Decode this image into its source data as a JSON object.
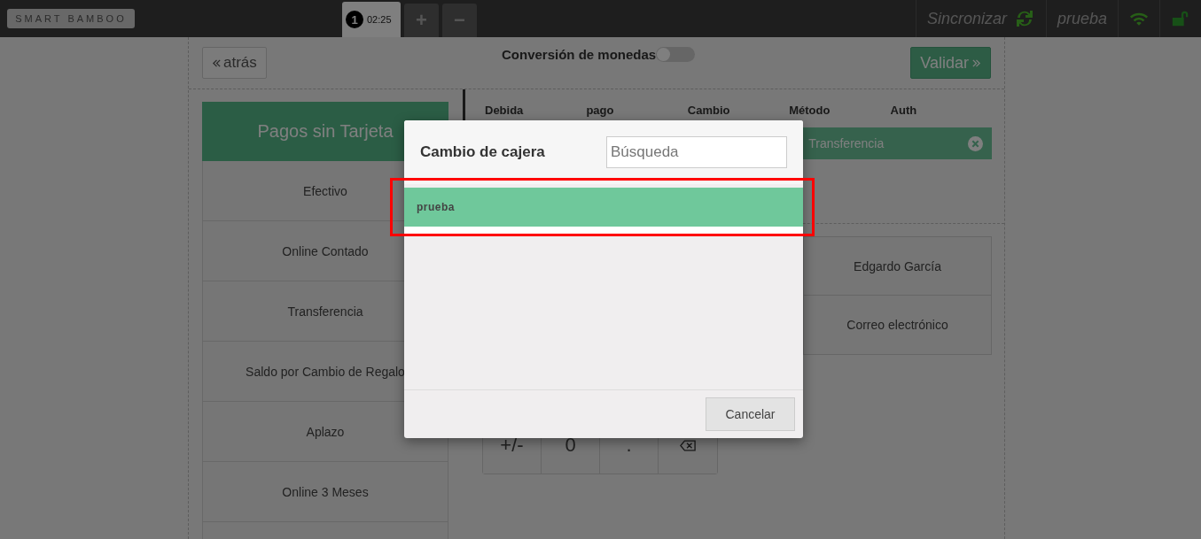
{
  "topbar": {
    "logo": "SMART BAMBOO",
    "tabs": [
      {
        "number": "1",
        "time": "02:25",
        "selected": true
      }
    ],
    "add_label": "+",
    "remove_label": "−",
    "sync_label": "Sincronizar",
    "user": "prueba"
  },
  "header": {
    "back_label": "atrás",
    "currency_toggle": {
      "label": "Conversión de monedas",
      "on": false
    },
    "validate_label": "Validar"
  },
  "payment_methods": {
    "title": "Pagos sin Tarjeta",
    "items": [
      "Efectivo",
      "Online Contado",
      "Transferencia",
      "Saldo por Cambio de Regalo",
      "Aplazo",
      "Online 3 Meses"
    ]
  },
  "payments_table": {
    "columns": [
      "Debida",
      "pago",
      "Cambio",
      "Método",
      "Auth"
    ],
    "rows": [
      {
        "method": "Transferencia"
      }
    ]
  },
  "options": [
    "Edgardo García",
    "Correo electrónico"
  ],
  "keypad": [
    {
      "kind": "text",
      "label": "+/-"
    },
    {
      "kind": "text",
      "label": "0"
    },
    {
      "kind": "text",
      "label": "."
    },
    {
      "kind": "backspace"
    }
  ],
  "modal": {
    "title": "Cambio de cajera",
    "search_placeholder": "Búsqueda",
    "cashiers": [
      {
        "name": "prueba",
        "selected": true
      }
    ],
    "cancel_label": "Cancelar"
  }
}
